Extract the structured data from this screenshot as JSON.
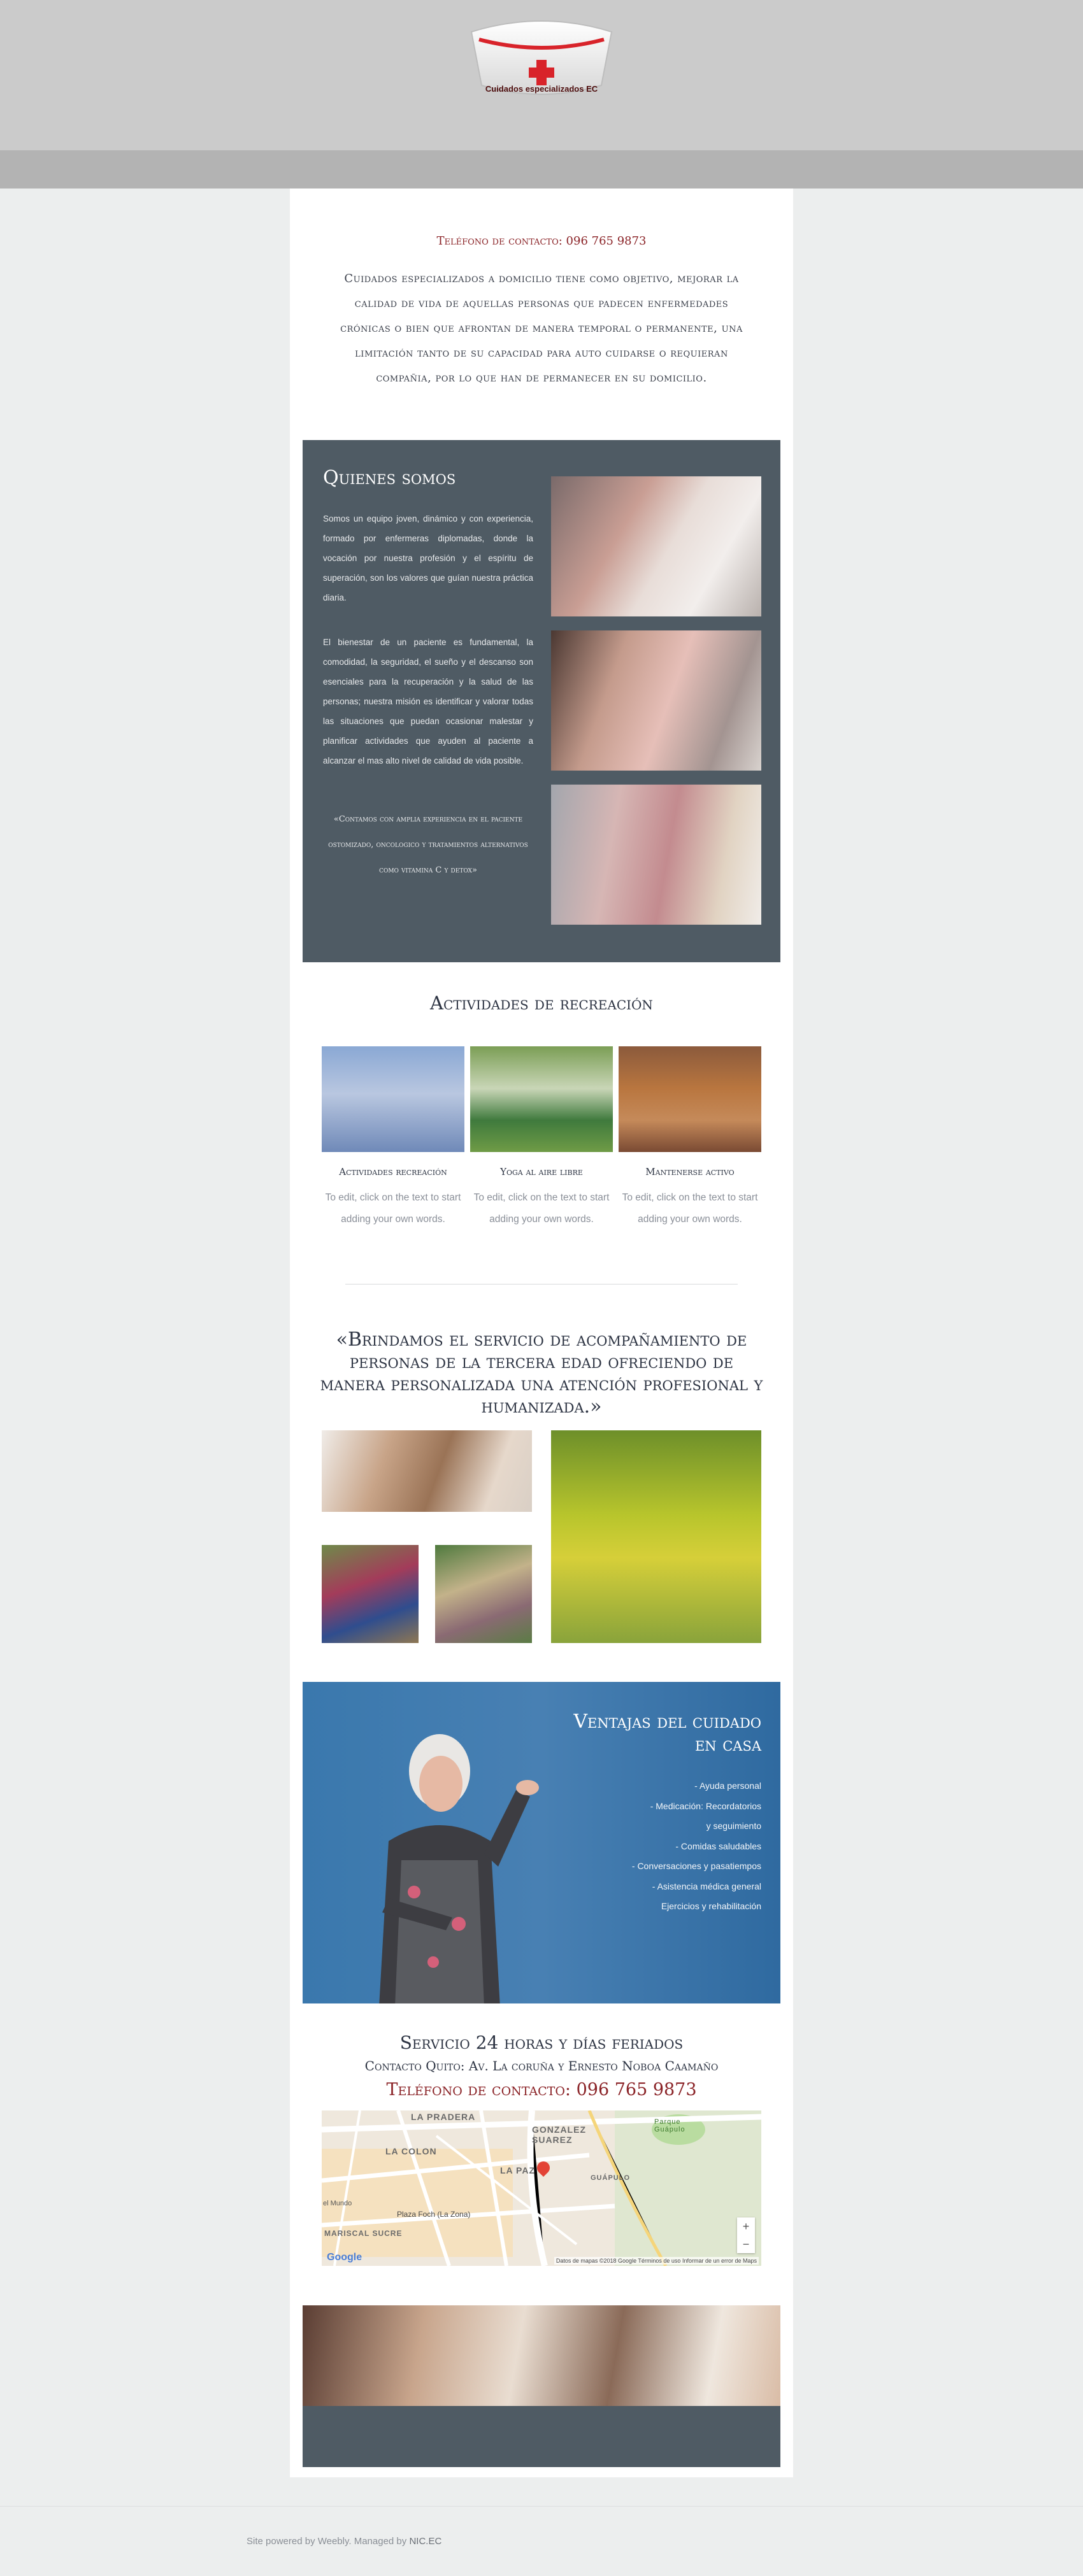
{
  "header": {
    "logo_text": "Cuidados especializados EC",
    "colors": {
      "header_bg": "#cbcbcb",
      "band_bg": "#b3b3b3",
      "cross": "#d8232a"
    }
  },
  "intro": {
    "phone": "Teléfono de contacto: 096 765 9873",
    "text": "Cuidados especializados a domicilio tiene como objetivo, mejorar la calidad de vida de aquellas personas que padecen enfermedades crónicas o bien que afrontan de manera temporal o permanente, una limitación tanto de su capacidad para auto cuidarse o requieran compañia, por lo que han de permanecer en su domicilio."
  },
  "about": {
    "title": "Quienes somos",
    "para1": "Somos un equipo joven, dinámico y con experiencia, formado por enfermeras diplomadas, donde la vocación por nuestra profesión y el espíritu de superación, son los valores que guían nuestra práctica diaria.",
    "para2": "El bienestar de un paciente es fundamental, la comodidad, la seguridad, el sueño y el descanso son esenciales para la recuperación y la salud de las personas; nuestra misión es identificar y valorar todas las situaciones que puedan ocasionar malestar y planificar actividades que ayuden al paciente a alcanzar el mas alto nivel de calidad de vida posible.",
    "quote": "«Contamos con amplia experiencia en el paciente ostomizado, oncologico y tratamientos alternativos como vitamina C y detox»",
    "bg_color": "#4f5b64"
  },
  "activities": {
    "title": "Actividades de recreación",
    "items": [
      {
        "caption": "Actividades recreación",
        "text": "To edit, click on the text to start adding your own words."
      },
      {
        "caption": "Yoga al aire libre",
        "text": "To edit, click on the text to start adding your own words."
      },
      {
        "caption": "Mantenerse activo",
        "text": "To edit, click on the text to start adding your own words."
      }
    ]
  },
  "service_quote": "«Brindamos el servicio de acompañamiento de personas de la tercera edad ofreciendo de manera personalizada una atención profesional y humanizada.»",
  "ventajas": {
    "title": "Ventajas del cuidado en casa",
    "items": [
      "- Ayuda personal",
      "- Medicación: Recordatorios",
      "y seguimiento",
      "- Comidas saludables",
      "- Conversaciones y pasatiempos",
      "- Asistencia médica general",
      "Ejercicios y rehabilitación"
    ],
    "bg_color": "#3a78ad"
  },
  "contact": {
    "title": "Servicio 24 horas y días feriados",
    "address": "Contacto Quito: Av. La coruña y Ernesto Noboa Caamaño",
    "phone": "Teléfono de contacto: 096 765 9873"
  },
  "map": {
    "labels": [
      "LA PRADERA",
      "GONZALEZ SUAREZ",
      "LA COLON",
      "LA PAZ",
      "GUÁPULO",
      "Parque Guápulo",
      "Plaza Foch (La Zona)",
      "MARISCAL SUCRE",
      "el Mundo"
    ],
    "google": "Google",
    "attribution": "Datos de mapas ©2018 Google   Términos de uso   Informar de un error de Maps",
    "zoom_in": "+",
    "zoom_out": "−"
  },
  "footer": {
    "prefix": "Site powered by Weebly. Managed by",
    "link": "NIC.EC"
  }
}
